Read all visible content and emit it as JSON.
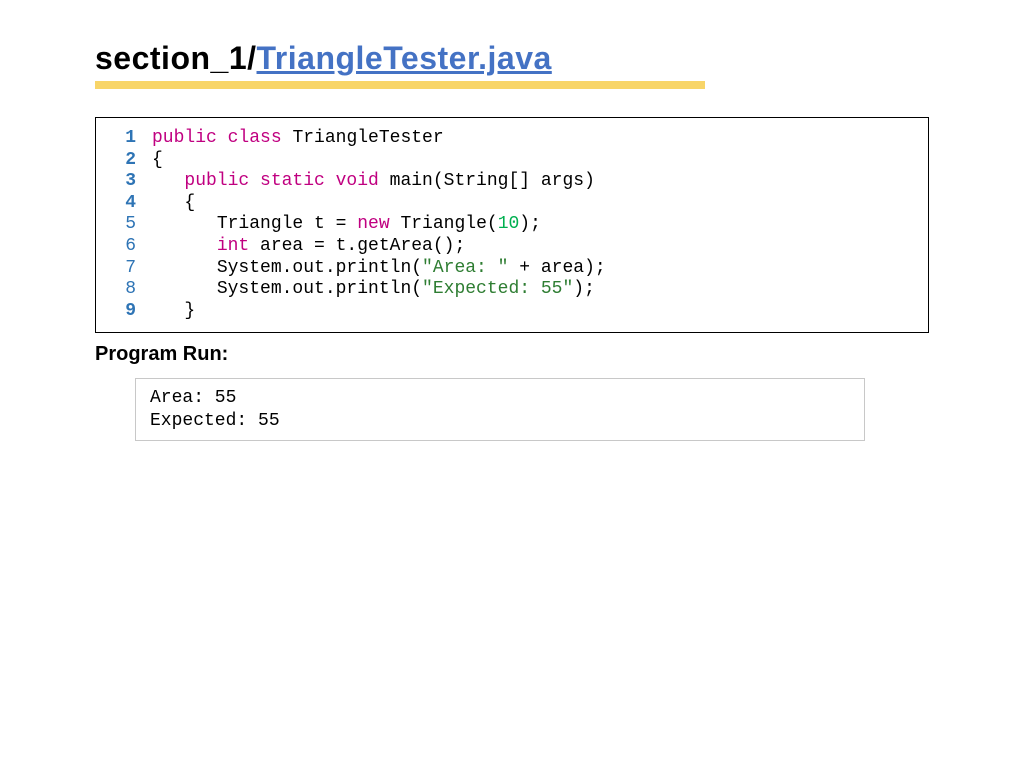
{
  "title": {
    "prefix": "section_1/",
    "filename": "TriangleTester.java"
  },
  "code": {
    "lines": [
      {
        "num": "1",
        "bold": true
      },
      {
        "num": "2",
        "bold": true
      },
      {
        "num": "3",
        "bold": true
      },
      {
        "num": "4",
        "bold": true
      },
      {
        "num": "5",
        "bold": false
      },
      {
        "num": "6",
        "bold": false
      },
      {
        "num": "7",
        "bold": false
      },
      {
        "num": "8",
        "bold": false
      },
      {
        "num": "9",
        "bold": true
      }
    ],
    "l1": {
      "kw": "public class ",
      "rest": "TriangleTester"
    },
    "l2": "{",
    "l3": {
      "kw": "public static void ",
      "rest": "main(String[] args)"
    },
    "l4": "{",
    "l5": {
      "a": "Triangle t = ",
      "kw": "new",
      "b": " Triangle(",
      "num": "10",
      "c": ");"
    },
    "l6": {
      "type": "int",
      "rest": " area = t.getArea();"
    },
    "l7": {
      "a": "System.out.println(",
      "str": "\"Area: \"",
      "b": " + area);"
    },
    "l8": {
      "a": "System.out.println(",
      "str": "\"Expected: 55\"",
      "b": ");"
    },
    "l9": "}"
  },
  "run": {
    "heading": "Program Run:",
    "out1": "Area: 55",
    "out2": "Expected: 55"
  }
}
